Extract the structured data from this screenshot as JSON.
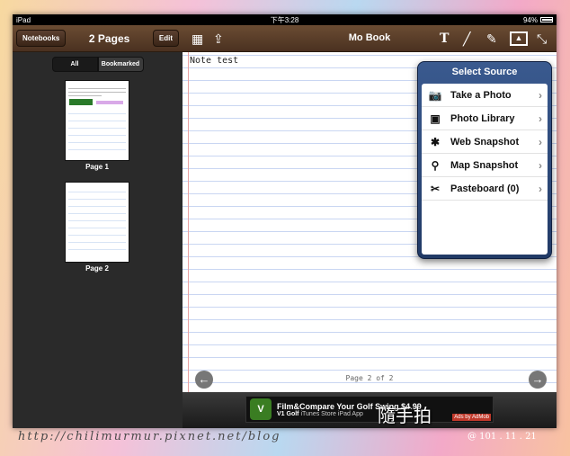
{
  "statusbar": {
    "device": "iPad",
    "time": "下午3:28",
    "battery": "94%",
    "battery_level": 0.94
  },
  "sidebar": {
    "notebooks_label": "Notebooks",
    "title": "2 Pages",
    "edit_label": "Edit",
    "seg_all": "All",
    "seg_bookmarked": "Bookmarked",
    "pages": [
      {
        "caption": "Page 1"
      },
      {
        "caption": "Page 2"
      }
    ]
  },
  "main": {
    "title": "Mo Book",
    "note_text": "Note test",
    "page_indicator": "Page 2 of 2"
  },
  "popover": {
    "title": "Select Source",
    "items": [
      {
        "label": "Take a Photo",
        "icon": "camera-icon"
      },
      {
        "label": "Photo Library",
        "icon": "photo-library-icon"
      },
      {
        "label": "Web Snapshot",
        "icon": "web-snapshot-icon"
      },
      {
        "label": "Map Snapshot",
        "icon": "map-pin-icon"
      },
      {
        "label": "Pasteboard (0)",
        "icon": "scissors-icon"
      }
    ]
  },
  "ad": {
    "title": "Film&Compare Your Golf Swing $4.99",
    "app": "V1 Golf",
    "sub": "iTunes Store iPad App",
    "tag": "Ads by AdMob"
  },
  "watermark": {
    "url": "http://chilimurmur.pixnet.net/blog",
    "date": "@ 101 . 11 . 21"
  }
}
